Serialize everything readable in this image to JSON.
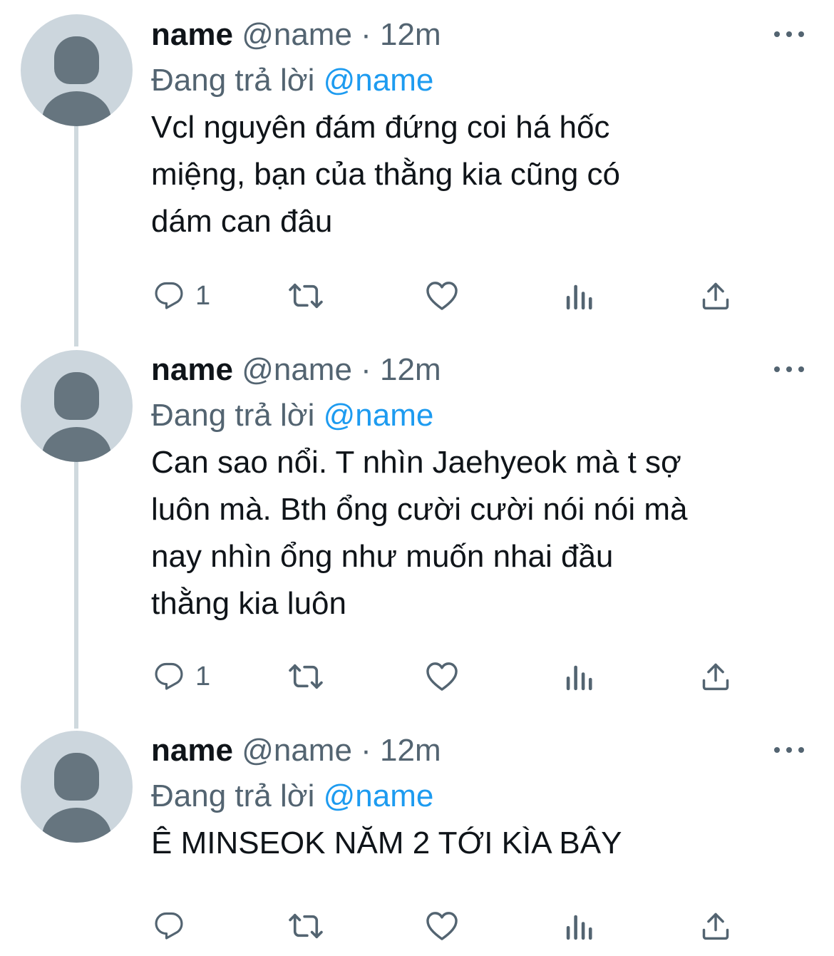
{
  "tweets": [
    {
      "display_name": "name",
      "handle": "@name",
      "separator": "·",
      "time": "12m",
      "reply_prefix": "Đang trả lời",
      "reply_mention": "@name",
      "text": "Vcl nguyên đám đứng coi há hốc\nmiệng, bạn của thằng kia cũng có\ndám can đâu",
      "reply_count": "1"
    },
    {
      "display_name": "name",
      "handle": "@name",
      "separator": "·",
      "time": "12m",
      "reply_prefix": "Đang trả lời",
      "reply_mention": "@name",
      "text": "Can sao nổi. T nhìn Jaehyeok mà t sợ\nluôn mà. Bth ổng cười cười nói nói mà\nnay nhìn ổng như muốn nhai đầu\nthằng kia luôn",
      "reply_count": "1"
    },
    {
      "display_name": "name",
      "handle": "@name",
      "separator": "·",
      "time": "12m",
      "reply_prefix": "Đang trả lời",
      "reply_mention": "@name",
      "text": "Ê MINSEOK NĂM 2 TỚI KÌA BÂY",
      "reply_count": ""
    }
  ],
  "icons": {
    "reply": "reply-icon",
    "retweet": "retweet-icon",
    "like": "heart-icon",
    "views": "views-icon",
    "share": "share-icon",
    "more": "more-icon"
  },
  "colors": {
    "text": "#0f1419",
    "secondary": "#536471",
    "mention": "#1d9bf0",
    "avatar_bg": "#ccd6dd",
    "avatar_fg": "#66757f",
    "thread_line": "#cfd9de"
  }
}
